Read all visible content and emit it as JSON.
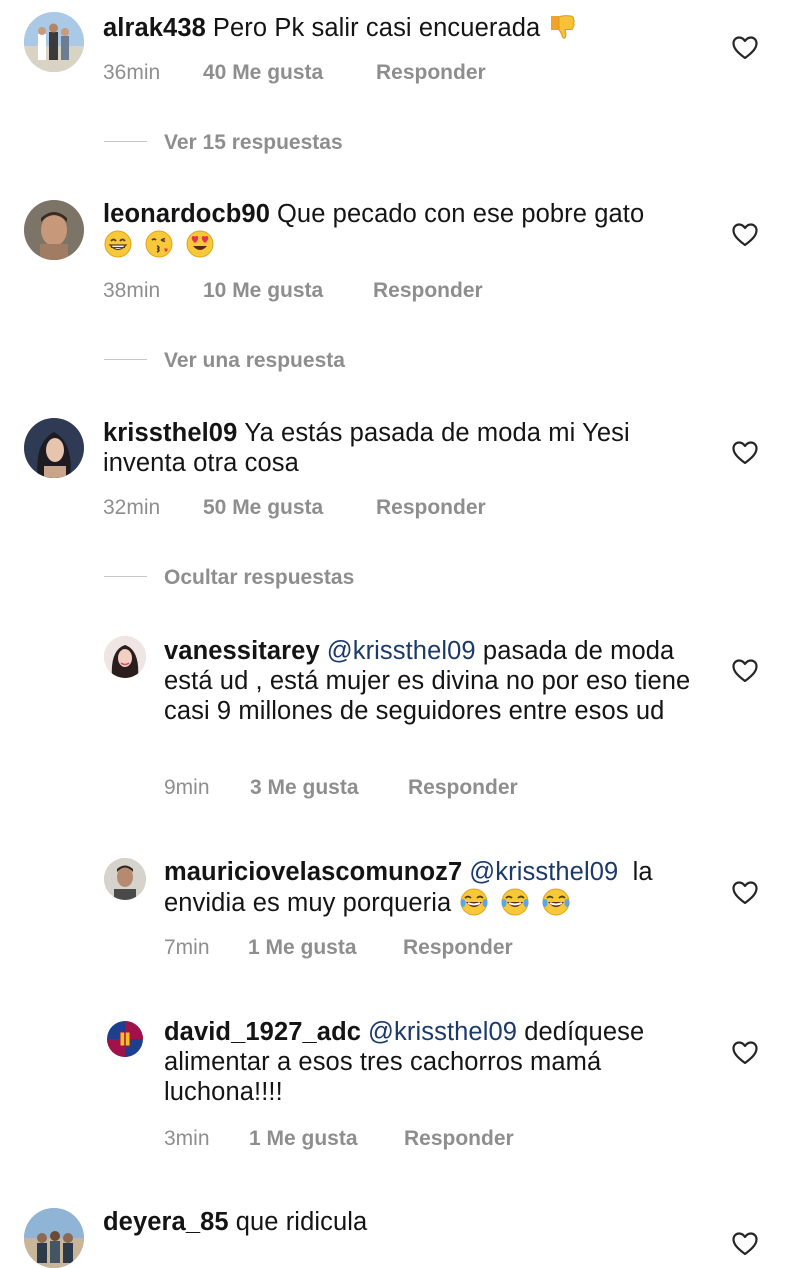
{
  "comments": [
    {
      "user": "alrak438",
      "text": "Pero Pk salir casi encuerada",
      "emoji": [
        "thumbs-down"
      ],
      "time": "36min",
      "likes": "40 Me gusta",
      "reply": "Responder",
      "thread": "Ver 15 respuestas"
    },
    {
      "user": "leonardocb90",
      "text": "Que pecado con ese pobre gato",
      "emoji": [
        "grinning-smiling-eyes",
        "face-blowing-kiss",
        "heart-eyes"
      ],
      "time": "38min",
      "likes": "10 Me gusta",
      "reply": "Responder",
      "thread": "Ver una respuesta"
    },
    {
      "user": "krissthel09",
      "text": "Ya estás pasada de moda mi Yesi inventa otra cosa",
      "time": "32min",
      "likes": "50 Me gusta",
      "reply": "Responder",
      "thread": "Ocultar respuestas",
      "replies": [
        {
          "user": "vanessitarey",
          "mention": "@krissthel09",
          "text": "pasada de moda está ud , está mujer es divina no por eso tiene casi 9 millones de seguidores entre esos ud",
          "time": "9min",
          "likes": "3 Me gusta",
          "reply": "Responder"
        },
        {
          "user": "mauriciovelascomunoz7",
          "mention": "@krissthel09",
          "text": "la envidia es muy porqueria",
          "emoji": [
            "tears-of-joy",
            "tears-of-joy",
            "tears-of-joy"
          ],
          "time": "7min",
          "likes": "1 Me gusta",
          "reply": "Responder"
        },
        {
          "user": "david_1927_adc",
          "mention": "@krissthel09",
          "text": "dedíquese alimentar a esos tres cachorros mamá luchona!!!!",
          "time": "3min",
          "likes": "1 Me gusta",
          "reply": "Responder"
        }
      ]
    },
    {
      "user": "deyera_85",
      "text": "que ridicula"
    }
  ],
  "colors": {
    "text": "#141414",
    "meta": "#8e8e8e",
    "mention": "#1b3a6b",
    "divider": "#c7c7c7"
  },
  "icons": {
    "like": "heart-outline-icon"
  }
}
